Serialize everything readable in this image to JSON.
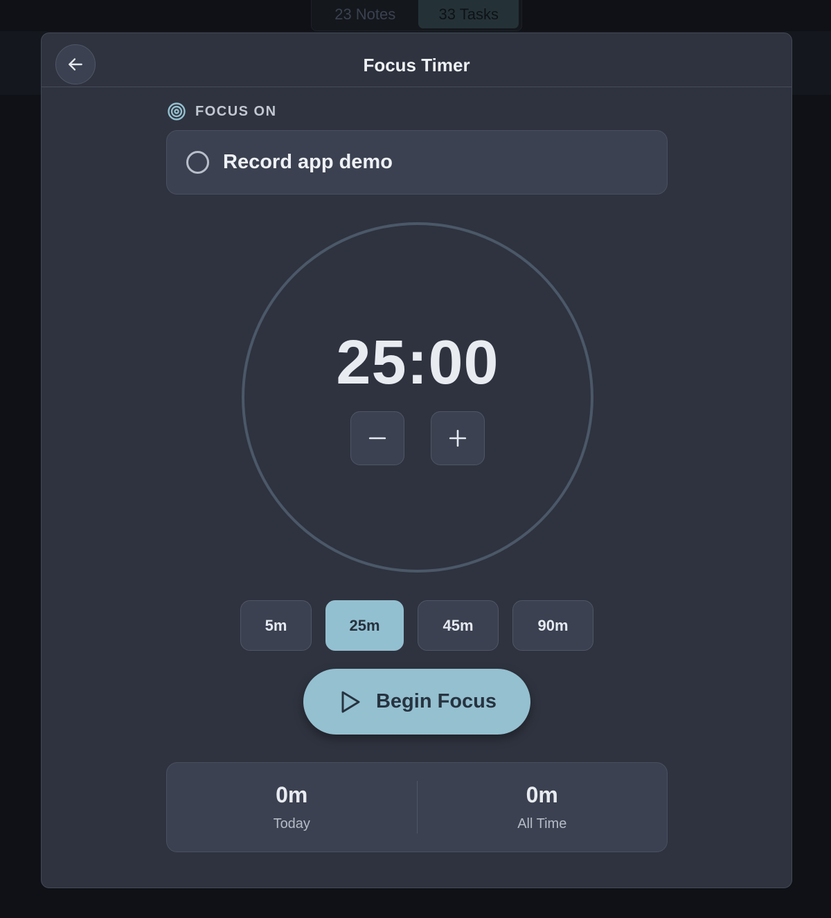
{
  "top_tabs": {
    "notes": "23 Notes",
    "tasks": "33 Tasks"
  },
  "header": {
    "title": "Focus Timer",
    "back_icon": "arrow-left-icon"
  },
  "focus": {
    "label": "FOCUS ON",
    "task": "Record app demo"
  },
  "timer": {
    "display": "25:00"
  },
  "presets": {
    "p5": "5m",
    "p25": "25m",
    "p45": "45m",
    "p90": "90m",
    "selected": "25m"
  },
  "begin": {
    "label": "Begin Focus"
  },
  "stats": {
    "today_value": "0m",
    "today_label": "Today",
    "alltime_value": "0m",
    "alltime_label": "All Time"
  },
  "colors": {
    "accent": "#94c0d0",
    "background": "#0f1116",
    "panel": "#2f333f",
    "card": "#3b4150",
    "ring": "#4b5868"
  }
}
